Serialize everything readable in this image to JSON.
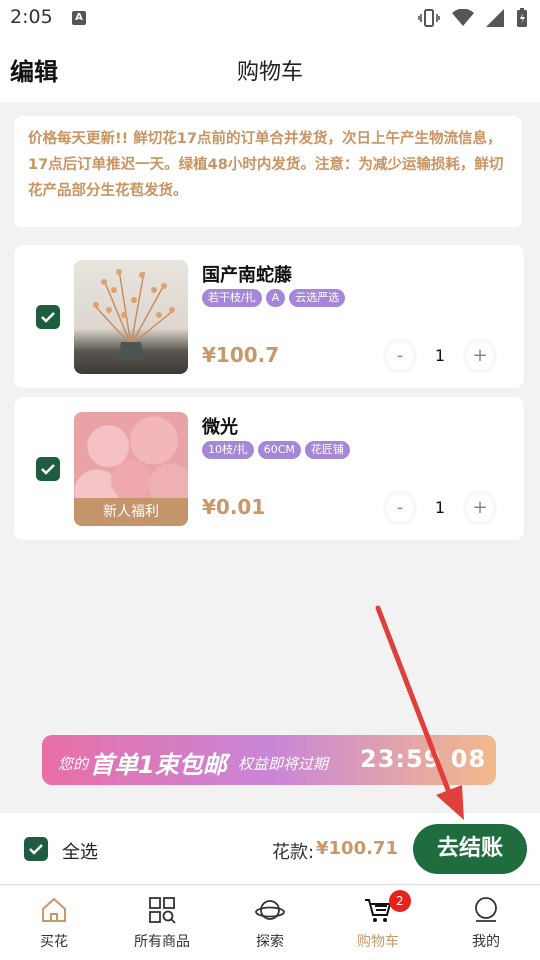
{
  "status_bar": {
    "time": "2:05",
    "notification_letter": "A"
  },
  "header": {
    "edit_label": "编辑",
    "title": "购物车"
  },
  "notice": "价格每天更新!! 鲜切花17点前的订单合并发货，次日上午产生物流信息，17点后订单推迟一天。绿植48小时内发货。注意：为减少运输损耗，鲜切花产品部分生花苞发货。",
  "cart_items": [
    {
      "name": "国产南蛇藤",
      "tags": [
        "若干枝/扎",
        "A",
        "云选严选"
      ],
      "price": "¥100.7",
      "quantity": "1",
      "selected": true,
      "image_banner": ""
    },
    {
      "name": "微光",
      "tags": [
        "10枝/扎",
        "60CM",
        "花匠铺"
      ],
      "price": "¥0.01",
      "quantity": "1",
      "selected": true,
      "image_banner": "新人福利"
    }
  ],
  "stepper": {
    "minus": "-",
    "plus": "+"
  },
  "promo": {
    "prefix": "您的",
    "headline": "首单1束包邮",
    "suffix": "权益即将过期",
    "countdown": "23:59 08"
  },
  "checkout": {
    "select_all_label": "全选",
    "total_label": "花款:",
    "total_value": "¥100.71",
    "pay_button": "去结账"
  },
  "tabbar": {
    "items": [
      {
        "label": "买花",
        "icon": "home-icon"
      },
      {
        "label": "所有商品",
        "icon": "grid-search-icon"
      },
      {
        "label": "探索",
        "icon": "planet-icon"
      },
      {
        "label": "购物车",
        "icon": "cart-icon",
        "badge": "2",
        "active": true
      },
      {
        "label": "我的",
        "icon": "user-icon"
      }
    ]
  },
  "colors": {
    "accent_green": "#1f6d3f",
    "price_gold": "#c9986a",
    "tag_purple": "#a587d9",
    "badge_red": "#e7221c"
  }
}
